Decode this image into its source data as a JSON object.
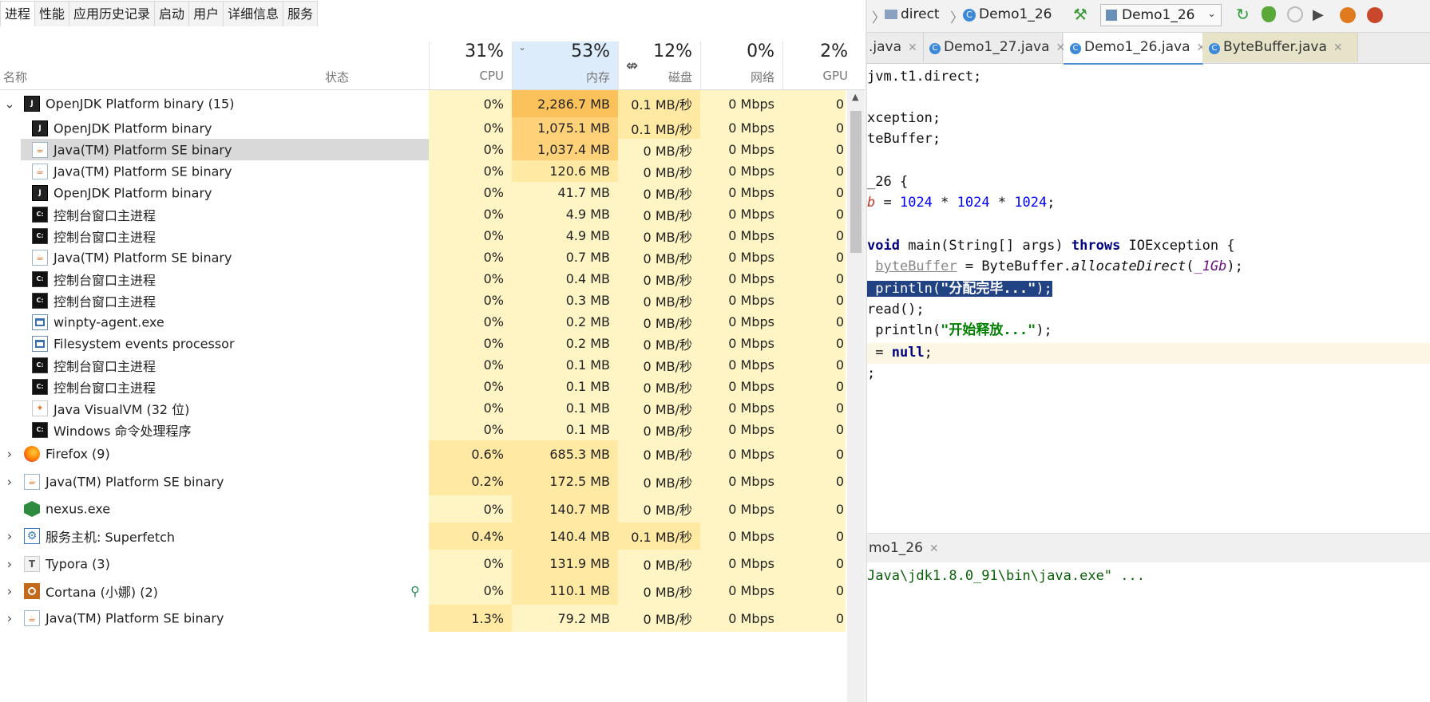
{
  "task_manager": {
    "tabs": [
      "进程",
      "性能",
      "应用历史记录",
      "启动",
      "用户",
      "详细信息",
      "服务"
    ],
    "active_tab": "进程",
    "columns": {
      "name": "名称",
      "status": "状态",
      "cpu": {
        "pct": "31%",
        "label": "CPU"
      },
      "memory": {
        "pct": "53%",
        "label": "内存"
      },
      "disk": {
        "pct": "12%",
        "label": "磁盘"
      },
      "network": {
        "pct": "0%",
        "label": "网络"
      },
      "gpu": {
        "pct": "2%",
        "label": "GPU"
      }
    },
    "sorted_column": "memory",
    "rows": [
      {
        "kind": "group",
        "expanded": true,
        "icon": "openjdk-icon",
        "name": "OpenJDK Platform binary (15)",
        "cpu": "0%",
        "mem": "2,286.7 MB",
        "disk": "0.1 MB/秒",
        "net": "0 Mbps",
        "gpu": "0"
      },
      {
        "kind": "child",
        "icon": "openjdk-icon",
        "name": "OpenJDK Platform binary",
        "cpu": "0%",
        "mem": "1,075.1 MB",
        "disk": "0.1 MB/秒",
        "net": "0 Mbps",
        "gpu": "0"
      },
      {
        "kind": "child",
        "icon": "java-icon",
        "name": "Java(TM) Platform SE binary",
        "cpu": "0%",
        "mem": "1,037.4 MB",
        "disk": "0 MB/秒",
        "net": "0 Mbps",
        "gpu": "0",
        "selected": true
      },
      {
        "kind": "child",
        "icon": "java-icon",
        "name": "Java(TM) Platform SE binary",
        "cpu": "0%",
        "mem": "120.6 MB",
        "disk": "0 MB/秒",
        "net": "0 Mbps",
        "gpu": "0"
      },
      {
        "kind": "child",
        "icon": "openjdk-icon",
        "name": "OpenJDK Platform binary",
        "cpu": "0%",
        "mem": "41.7 MB",
        "disk": "0 MB/秒",
        "net": "0 Mbps",
        "gpu": "0"
      },
      {
        "kind": "child",
        "icon": "console-icon",
        "name": "控制台窗口主进程",
        "cpu": "0%",
        "mem": "4.9 MB",
        "disk": "0 MB/秒",
        "net": "0 Mbps",
        "gpu": "0"
      },
      {
        "kind": "child",
        "icon": "console-icon",
        "name": "控制台窗口主进程",
        "cpu": "0%",
        "mem": "4.9 MB",
        "disk": "0 MB/秒",
        "net": "0 Mbps",
        "gpu": "0"
      },
      {
        "kind": "child",
        "icon": "java-icon",
        "name": "Java(TM) Platform SE binary",
        "cpu": "0%",
        "mem": "0.7 MB",
        "disk": "0 MB/秒",
        "net": "0 Mbps",
        "gpu": "0"
      },
      {
        "kind": "child",
        "icon": "console-icon",
        "name": "控制台窗口主进程",
        "cpu": "0%",
        "mem": "0.4 MB",
        "disk": "0 MB/秒",
        "net": "0 Mbps",
        "gpu": "0"
      },
      {
        "kind": "child",
        "icon": "console-icon",
        "name": "控制台窗口主进程",
        "cpu": "0%",
        "mem": "0.3 MB",
        "disk": "0 MB/秒",
        "net": "0 Mbps",
        "gpu": "0"
      },
      {
        "kind": "child",
        "icon": "window-icon",
        "name": "winpty-agent.exe",
        "cpu": "0%",
        "mem": "0.2 MB",
        "disk": "0 MB/秒",
        "net": "0 Mbps",
        "gpu": "0"
      },
      {
        "kind": "child",
        "icon": "window-icon",
        "name": "Filesystem events processor",
        "cpu": "0%",
        "mem": "0.2 MB",
        "disk": "0 MB/秒",
        "net": "0 Mbps",
        "gpu": "0"
      },
      {
        "kind": "child",
        "icon": "console-icon",
        "name": "控制台窗口主进程",
        "cpu": "0%",
        "mem": "0.1 MB",
        "disk": "0 MB/秒",
        "net": "0 Mbps",
        "gpu": "0"
      },
      {
        "kind": "child",
        "icon": "console-icon",
        "name": "控制台窗口主进程",
        "cpu": "0%",
        "mem": "0.1 MB",
        "disk": "0 MB/秒",
        "net": "0 Mbps",
        "gpu": "0"
      },
      {
        "kind": "child",
        "icon": "visualvm-icon",
        "name": "Java VisualVM (32 位)",
        "cpu": "0%",
        "mem": "0.1 MB",
        "disk": "0 MB/秒",
        "net": "0 Mbps",
        "gpu": "0"
      },
      {
        "kind": "child",
        "icon": "console-icon",
        "name": "Windows 命令处理程序",
        "cpu": "0%",
        "mem": "0.1 MB",
        "disk": "0 MB/秒",
        "net": "0 Mbps",
        "gpu": "0"
      },
      {
        "kind": "group",
        "expanded": false,
        "icon": "firefox-icon",
        "name": "Firefox (9)",
        "cpu": "0.6%",
        "mem": "685.3 MB",
        "disk": "0 MB/秒",
        "net": "0 Mbps",
        "gpu": "0"
      },
      {
        "kind": "group",
        "expanded": false,
        "icon": "java-icon",
        "name": "Java(TM) Platform SE binary",
        "cpu": "0.2%",
        "mem": "172.5 MB",
        "disk": "0 MB/秒",
        "net": "0 Mbps",
        "gpu": "0"
      },
      {
        "kind": "group",
        "expanded": null,
        "icon": "nexus-icon",
        "name": "nexus.exe",
        "cpu": "0%",
        "mem": "140.7 MB",
        "disk": "0 MB/秒",
        "net": "0 Mbps",
        "gpu": "0"
      },
      {
        "kind": "group",
        "expanded": false,
        "icon": "service-host-icon",
        "name": "服务主机: Superfetch",
        "cpu": "0.4%",
        "mem": "140.4 MB",
        "disk": "0.1 MB/秒",
        "net": "0 Mbps",
        "gpu": "0"
      },
      {
        "kind": "group",
        "expanded": false,
        "icon": "typora-icon",
        "name": "Typora (3)",
        "cpu": "0%",
        "mem": "131.9 MB",
        "disk": "0 MB/秒",
        "net": "0 Mbps",
        "gpu": "0"
      },
      {
        "kind": "group",
        "expanded": false,
        "icon": "cortana-icon",
        "name": "Cortana (小娜) (2)",
        "cpu": "0%",
        "mem": "110.1 MB",
        "disk": "0 MB/秒",
        "net": "0 Mbps",
        "gpu": "0",
        "status_icon": "leaf-icon"
      },
      {
        "kind": "group",
        "expanded": false,
        "icon": "java-icon",
        "name": "Java(TM) Platform SE binary",
        "cpu": "1.3%",
        "mem": "79.2 MB",
        "disk": "0 MB/秒",
        "net": "0 Mbps",
        "gpu": "0"
      }
    ],
    "heat_colors": {
      "low": "#fff4c4",
      "mid": "#ffe9a3",
      "high": "#ffd27a",
      "max": "#fbc15a",
      "selected": "#d9d9d9"
    }
  },
  "ide": {
    "breadcrumb": {
      "folder": "direct",
      "class": "Demo1_26"
    },
    "run_config": "Demo1_26",
    "tabs": [
      {
        "label": ".java",
        "active": false,
        "icon": false
      },
      {
        "label": "Demo1_27.java",
        "active": false,
        "icon": true
      },
      {
        "label": "Demo1_26.java",
        "active": true,
        "icon": true
      },
      {
        "label": "ByteBuffer.java",
        "active": false,
        "icon": true
      }
    ],
    "code_lines": [
      "jvm.t1.direct;",
      "",
      "xception;",
      "teBuffer;",
      "",
      "_26 {",
      "b = 1024 * 1024 * 1024;",
      "",
      "void main(String[] args) throws IOException {",
      " byteBuffer = ByteBuffer.allocateDirect(_1Gb);",
      " println(\"分配完毕...\");",
      "read();",
      " println(\"开始释放...\");",
      " = null;",
      ";"
    ],
    "run_tab": "mo1_26",
    "console_line": "Java\\jdk1.8.0_91\\bin\\java.exe\" ..."
  }
}
